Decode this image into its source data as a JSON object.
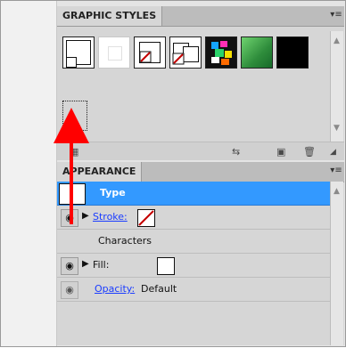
{
  "graphic_styles": {
    "tab_label": "GRAPHIC STYLES",
    "menu_icon": "panel-menu-icon",
    "toolbar_icons": [
      "style-libraries-icon",
      "break-link-icon",
      "new-graphic-style-icon",
      "delete-icon"
    ]
  },
  "appearance": {
    "tab_label": "APPEARANCE",
    "rows": [
      {
        "label": "Type",
        "selected": true
      },
      {
        "label": "Stroke:",
        "link": true,
        "has_triangle": true,
        "swatch": "none-stroke",
        "visible_eye": true
      },
      {
        "label": "Characters"
      },
      {
        "label": "Fill:",
        "has_triangle": true,
        "swatch": "white-fill",
        "visible_eye": true
      },
      {
        "label": "Opacity:",
        "link": true,
        "value": "Default",
        "visible_eye": true
      }
    ]
  },
  "colors": {
    "selection": "#3399ff",
    "arrow": "#ff0000",
    "panel_bg": "#d6d6d6"
  }
}
